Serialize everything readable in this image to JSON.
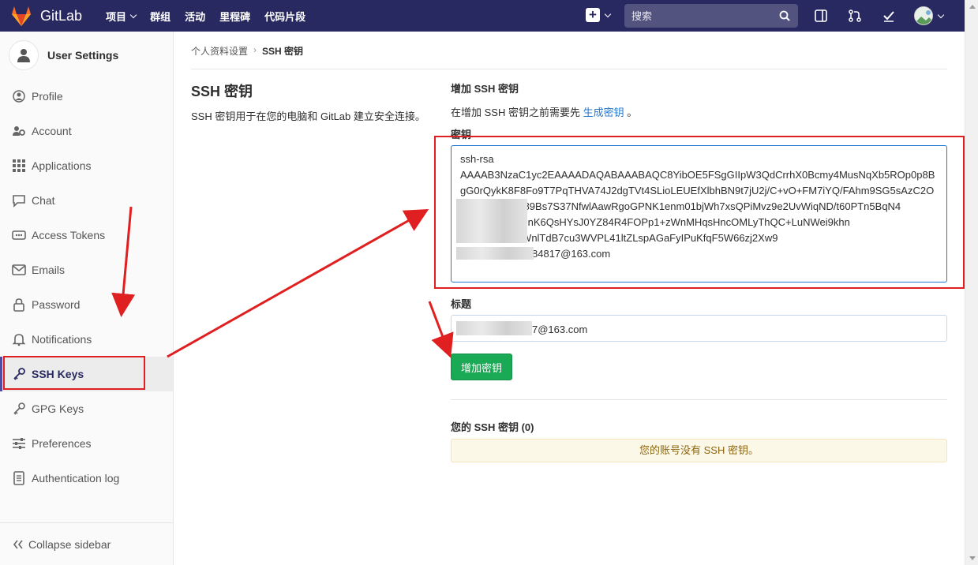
{
  "navbar": {
    "brand": "GitLab",
    "links": [
      {
        "label": "项目",
        "dropdown": true
      },
      {
        "label": "群组",
        "dropdown": false
      },
      {
        "label": "活动",
        "dropdown": false
      },
      {
        "label": "里程碑",
        "dropdown": false
      },
      {
        "label": "代码片段",
        "dropdown": false
      }
    ],
    "search_placeholder": "搜索",
    "colors": {
      "bg": "#292961",
      "accent": "#fc6d26"
    }
  },
  "sidebar": {
    "title": "User Settings",
    "items": [
      {
        "label": "Profile",
        "icon": "profile-icon"
      },
      {
        "label": "Account",
        "icon": "account-icon"
      },
      {
        "label": "Applications",
        "icon": "applications-icon"
      },
      {
        "label": "Chat",
        "icon": "chat-icon"
      },
      {
        "label": "Access Tokens",
        "icon": "access-tokens-icon"
      },
      {
        "label": "Emails",
        "icon": "emails-icon"
      },
      {
        "label": "Password",
        "icon": "lock-icon"
      },
      {
        "label": "Notifications",
        "icon": "bell-icon"
      },
      {
        "label": "SSH Keys",
        "icon": "key-icon",
        "active": true
      },
      {
        "label": "GPG Keys",
        "icon": "key-icon"
      },
      {
        "label": "Preferences",
        "icon": "preferences-icon"
      },
      {
        "label": "Authentication log",
        "icon": "log-icon"
      }
    ],
    "collapse_label": "Collapse sidebar"
  },
  "breadcrumb": {
    "parent": "个人资料设置",
    "current": "SSH 密钥"
  },
  "intro": {
    "title": "SSH 密钥",
    "description": "SSH 密钥用于在您的电脑和 GitLab 建立安全连接。"
  },
  "form": {
    "title": "增加 SSH 密钥",
    "desc_prefix": "在增加 SSH 密钥之前需要先",
    "desc_link": "生成密钥",
    "desc_suffix": "。",
    "key_label": "密钥",
    "key_value": "ssh-rsa\nAAAAB3NzaC1yc2EAAAADAQABAAABAQC8YibOE5FSgGIIpW3QdCrrhX0Bcmy4MusNqXb5ROp0p8BgG0rQykK8F8Fo9T7PqTHVA74J2dgTVt4SLioLEUEfXlbhBN9t7jU2j/C+vO+FM7iYQ/FAhm9SG5sAzC2O5LA8Y9krl+fzj89Bs7S37NfwlAawRgoGPNK1enm01bjWh7xsQPiMvz9e2UvWiqND/t60PTn5BqN4　　　　　　x+Id6yFmOqrJnK6QsHYsJ0YZ84R4FOPp1+zWnMHqsHncOMLyThQC+LuNWei9khn　　　　　　　J6uu3ZI2cGoWnlTdB7cu3WVPL41ltZLspAGaFyIPuKfqF5W66zj2Xw9\n　　　　　　　84817@163.com",
    "title_label": "标题",
    "title_value": "　　　　　　　7@163.com",
    "submit_label": "增加密钥"
  },
  "keys": {
    "title": "您的 SSH 密钥 (0)",
    "empty_message": "您的账号没有 SSH 密钥。"
  }
}
